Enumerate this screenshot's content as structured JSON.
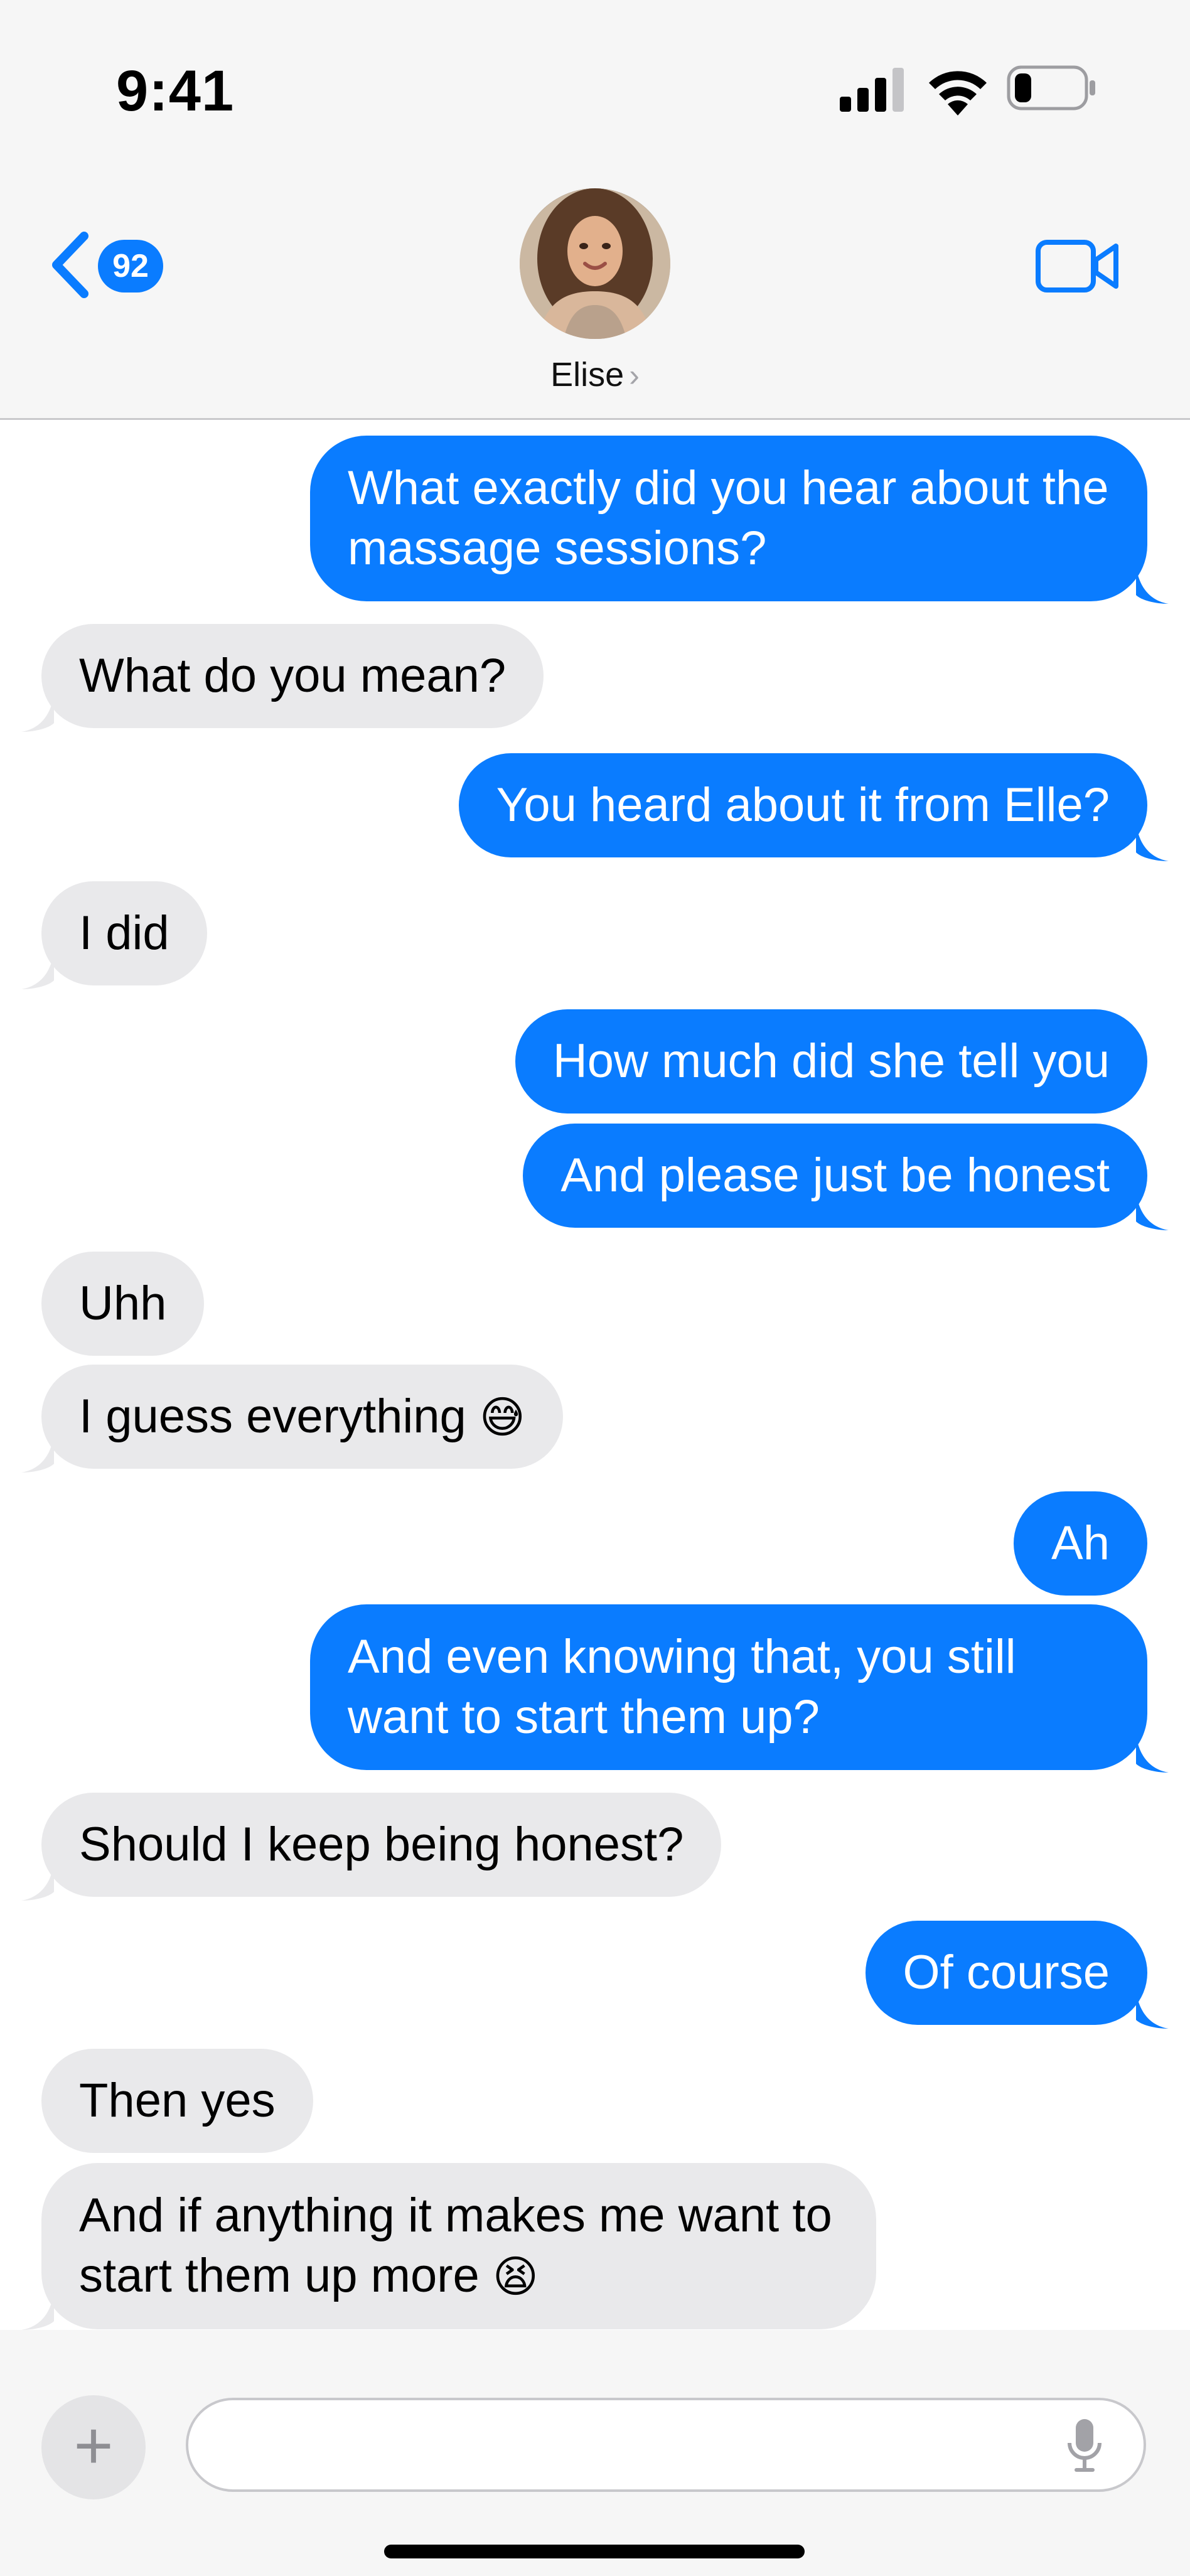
{
  "status_bar": {
    "time": "9:41",
    "battery_level": 0.25
  },
  "header": {
    "back_badge": "92",
    "contact_name": "Elise",
    "contact_chevron": "›",
    "icons": {
      "back": "chevron-left-icon",
      "video": "video-camera-icon"
    }
  },
  "messages": [
    {
      "dir": "out",
      "text": "What exactly did you hear about the massage sessions?"
    },
    {
      "dir": "in",
      "text": "What do you mean?"
    },
    {
      "dir": "out",
      "text": "You heard about it from Elle?"
    },
    {
      "dir": "in",
      "text": "I did"
    },
    {
      "dir": "out",
      "text": "How much did she tell you"
    },
    {
      "dir": "out",
      "text": "And please just be honest"
    },
    {
      "dir": "in",
      "text": "Uhh"
    },
    {
      "dir": "in",
      "text": "I guess everything 😅"
    },
    {
      "dir": "out",
      "text": "Ah"
    },
    {
      "dir": "out",
      "text": "And even knowing that, you still want to start them up?"
    },
    {
      "dir": "in",
      "text": "Should I keep being honest?"
    },
    {
      "dir": "out",
      "text": "Of course"
    },
    {
      "dir": "in",
      "text": "Then yes"
    },
    {
      "dir": "in",
      "text": "And if anything it makes me want to start them up more 😫"
    }
  ],
  "composer": {
    "add_label": "+",
    "message_value": "",
    "icons": {
      "add": "plus-icon",
      "mic": "microphone-icon"
    }
  },
  "colors": {
    "outgoing": "#0a7cff",
    "incoming": "#e9e9eb",
    "header_bg": "#f6f6f6"
  }
}
